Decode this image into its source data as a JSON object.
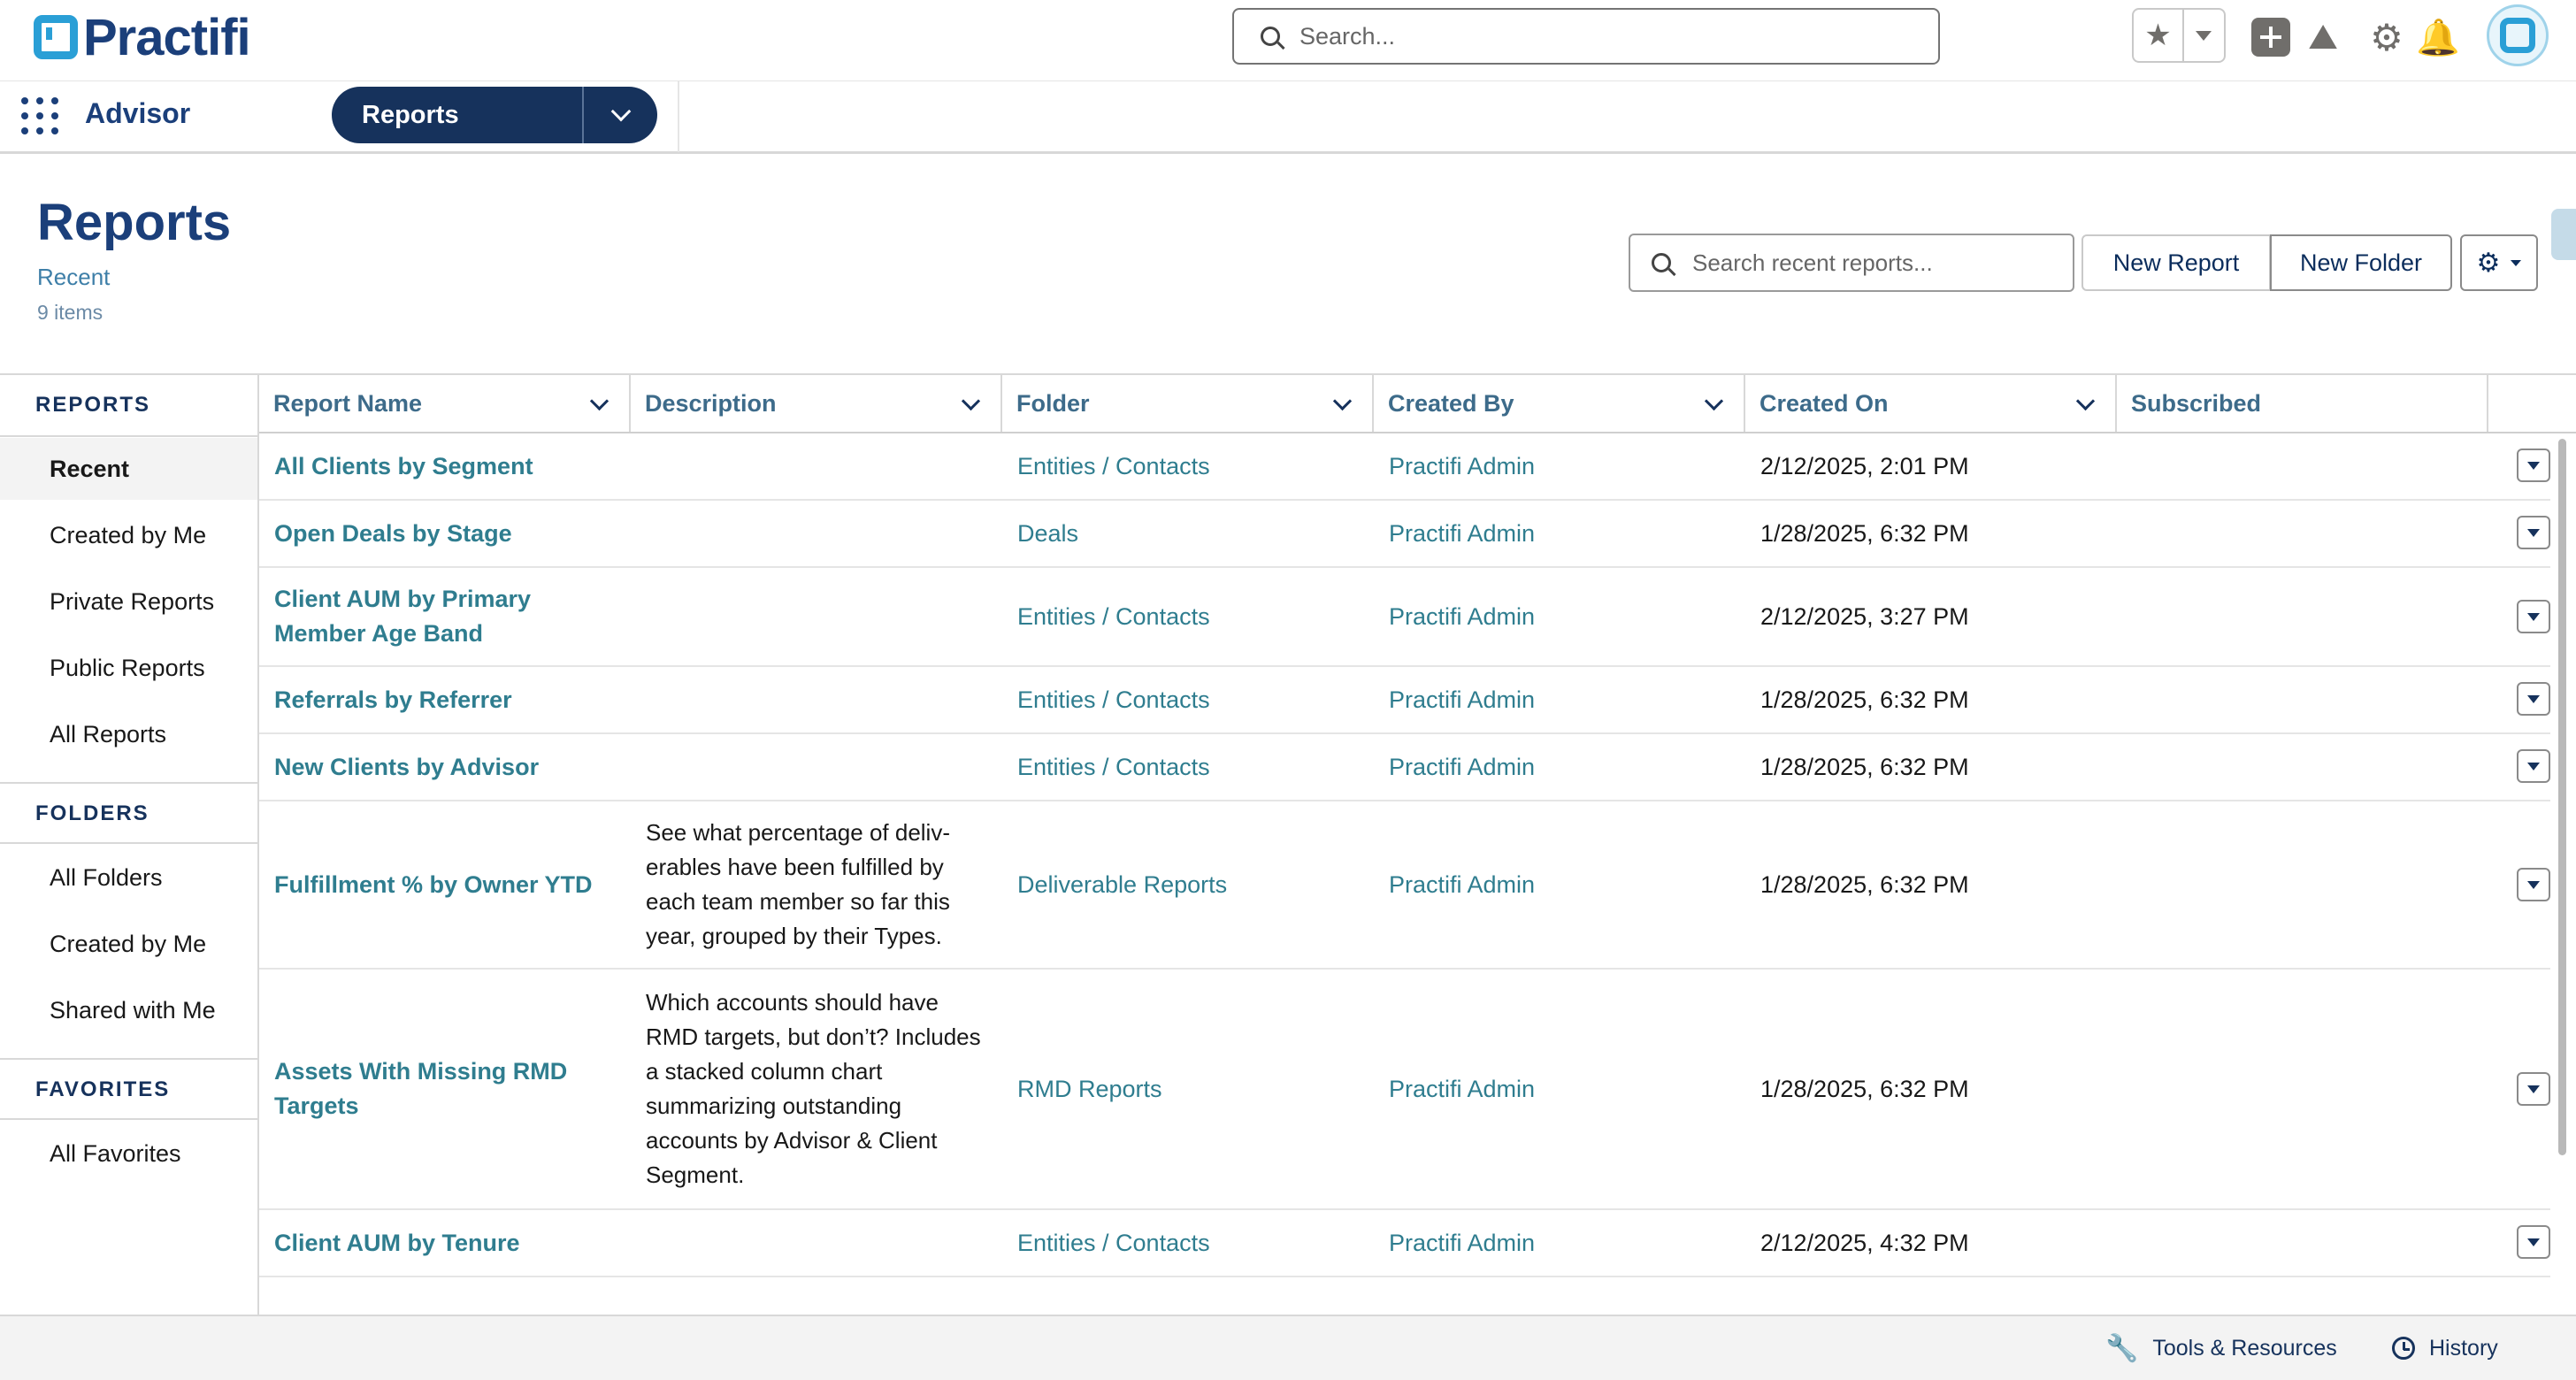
{
  "header": {
    "logo_text": "Practifi",
    "search_placeholder": "Search...",
    "icons": [
      "star-icon",
      "chevron-down-icon",
      "plus-icon",
      "trailhead-icon",
      "gear-icon",
      "bell-icon",
      "avatar"
    ]
  },
  "app_nav": {
    "app_name": "Advisor",
    "tab_label": "Reports"
  },
  "page": {
    "title": "Reports",
    "subtitle": "Recent",
    "count": "9 items",
    "search_placeholder": "Search recent reports...",
    "new_report_label": "New Report",
    "new_folder_label": "New Folder"
  },
  "sidebar": {
    "reports_title": "REPORTS",
    "reports_items": [
      "Recent",
      "Created by Me",
      "Private Reports",
      "Public Reports",
      "All Reports"
    ],
    "folders_title": "FOLDERS",
    "folders_items": [
      "All Folders",
      "Created by Me",
      "Shared with Me"
    ],
    "favorites_title": "FAVORITES",
    "favorites_items": [
      "All Favorites"
    ],
    "active_item": "Recent"
  },
  "table": {
    "columns": [
      "Report Name",
      "Description",
      "Folder",
      "Created By",
      "Created On",
      "Subscribed"
    ],
    "rows": [
      {
        "name": "All Clients by Segment",
        "description": "",
        "folder": "Entities / Contacts",
        "created_by": "Practifi Admin",
        "created_on": "2/12/2025, 2:01 PM"
      },
      {
        "name": "Open Deals by Stage",
        "description": "",
        "folder": "Deals",
        "created_by": "Practifi Admin",
        "created_on": "1/28/2025, 6:32 PM"
      },
      {
        "name": "Client AUM by Primary Member Age Band",
        "description": "",
        "folder": "Entities / Contacts",
        "created_by": "Practifi Admin",
        "created_on": "2/12/2025, 3:27 PM"
      },
      {
        "name": "Referrals by Referrer",
        "description": "",
        "folder": "Entities / Contacts",
        "created_by": "Practifi Admin",
        "created_on": "1/28/2025, 6:32 PM"
      },
      {
        "name": "New Clients by Advisor",
        "description": "",
        "folder": "Entities / Contacts",
        "created_by": "Practifi Admin",
        "created_on": "1/28/2025, 6:32 PM"
      },
      {
        "name": "Fulfillment % by Owner YTD",
        "description": "See what percentage of deliv- erables have been fulfilled by each team member so far this year, grouped by their Types.",
        "folder": "Deliverable Reports",
        "created_by": "Practifi Admin",
        "created_on": "1/28/2025, 6:32 PM"
      },
      {
        "name": "Assets With Missing RMD Targets",
        "description": "Which accounts should have RMD targets, but don’t? Includes a stacked column chart summarizing outstanding accounts by Advisor & Client Segment.",
        "folder": "RMD Reports",
        "created_by": "Practifi Admin",
        "created_on": "1/28/2025, 6:32 PM"
      },
      {
        "name": "Client AUM by Tenure",
        "description": "",
        "folder": "Entities / Contacts",
        "created_by": "Practifi Admin",
        "created_on": "2/12/2025, 4:32 PM"
      }
    ]
  },
  "footer": {
    "tools_label": "Tools & Resources",
    "history_label": "History"
  },
  "colors": {
    "brand_navy": "#1b3f7a",
    "pill_navy": "#16325c",
    "link_teal": "#2f7d8f",
    "logo_blue": "#2a9fd6"
  }
}
